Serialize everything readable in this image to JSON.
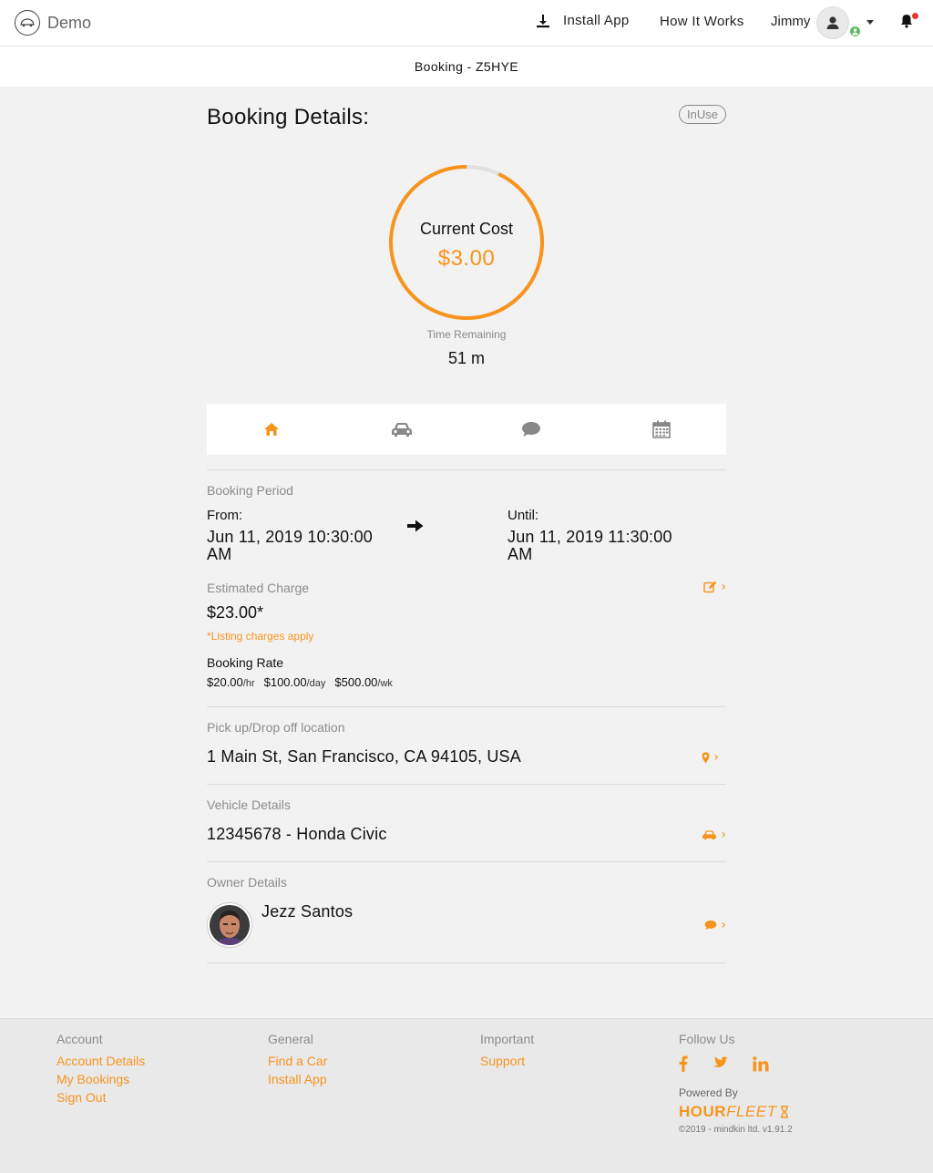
{
  "header": {
    "brand": "Demo",
    "install_label": "Install App",
    "how_label": "How It Works",
    "user_name": "Jimmy"
  },
  "subheader": {
    "title": "Booking - Z5HYE"
  },
  "booking": {
    "title": "Booking Details:",
    "status": "InUse",
    "cost_label": "Current Cost",
    "cost_value": "$3.00",
    "ring_progress": 0.93,
    "time_label": "Time Remaining",
    "time_value": "51 m",
    "tabs": [
      {
        "name": "home-icon",
        "active": true
      },
      {
        "name": "car-icon",
        "active": false
      },
      {
        "name": "chat-icon",
        "active": false
      },
      {
        "name": "calendar-icon",
        "active": false
      }
    ],
    "period_label": "Booking Period",
    "from_label": "From:",
    "from_value": "Jun 11, 2019 10:30:00 AM",
    "until_label": "Until:",
    "until_value": "Jun 11, 2019 11:30:00 AM",
    "charge_label": "Estimated Charge",
    "charge_value": "$23.00*",
    "charge_note": "*Listing charges apply",
    "rate_label": "Booking Rate",
    "rates": [
      {
        "amount": "$20.00",
        "unit": "/hr"
      },
      {
        "amount": "$100.00",
        "unit": "/day"
      },
      {
        "amount": "$500.00",
        "unit": "/wk"
      }
    ],
    "location_label": "Pick up/Drop off location",
    "location_value": "1 Main St, San Francisco, CA 94105, USA",
    "vehicle_label": "Vehicle Details",
    "vehicle_value": "12345678 - Honda Civic",
    "owner_label": "Owner Details",
    "owner_name": "Jezz Santos"
  },
  "footer": {
    "account": {
      "heading": "Account",
      "links": [
        "Account Details",
        "My Bookings",
        "Sign Out"
      ]
    },
    "general": {
      "heading": "General",
      "links": [
        "Find a Car",
        "Install App"
      ]
    },
    "important": {
      "heading": "Important",
      "links": [
        "Support"
      ]
    },
    "follow": {
      "heading": "Follow Us",
      "icons": [
        "facebook-icon",
        "twitter-icon",
        "linkedin-icon"
      ]
    },
    "powered": "Powered By",
    "hourfleet_a": "HOUR",
    "hourfleet_b": "FLEET",
    "copyright": "©2019 - mindkin ltd. v1.91.2"
  },
  "colors": {
    "accent": "#f7941d",
    "status_online": "#5cb85c",
    "notification": "#e53935"
  }
}
